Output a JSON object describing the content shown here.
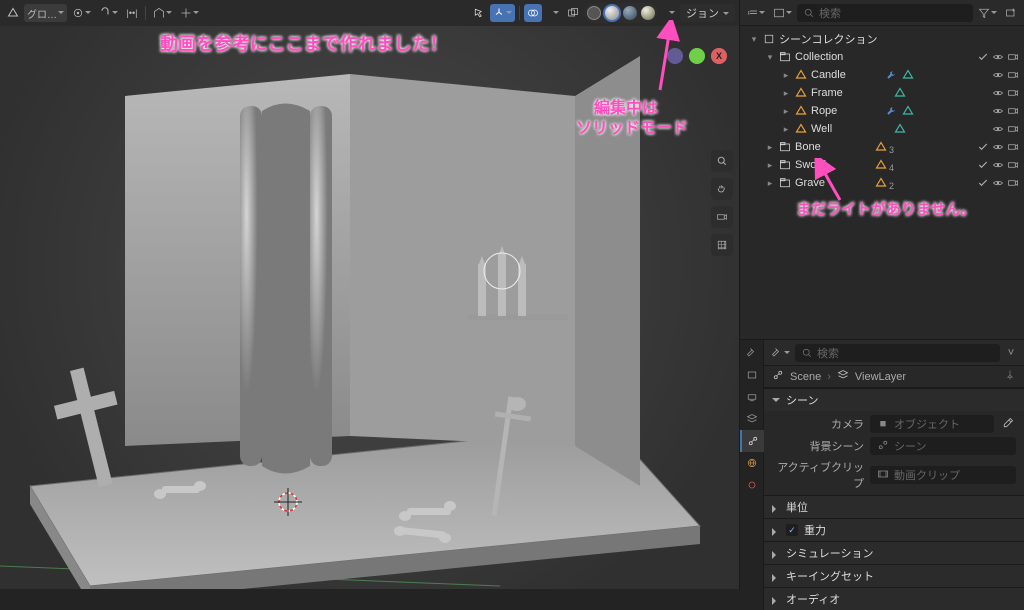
{
  "viewport": {
    "mode_label": "グロ…",
    "options_label": "ジョン",
    "shading_names": [
      "wireframe",
      "solid",
      "material",
      "rendered"
    ]
  },
  "annotations": {
    "top": "動画を参考にここまで作れました！",
    "mid1": "編集中は",
    "mid2": "ソリッドモード",
    "right": "まだライトがありません。"
  },
  "gizmo": {
    "x": "X",
    "y": "Y",
    "z": "Z"
  },
  "outliner": {
    "search_placeholder": "検索",
    "scene_collection": "シーンコレクション",
    "rows": [
      {
        "depth": 0,
        "tw": "▾",
        "icon": "scene",
        "label": "シーンコレクション",
        "icons": []
      },
      {
        "depth": 1,
        "tw": "▾",
        "icon": "coll",
        "label": "Collection",
        "icons": [
          "chk",
          "eye",
          "cam"
        ]
      },
      {
        "depth": 2,
        "tw": "▸",
        "icon": "mesh",
        "label": "Candle",
        "mods": [
          "wrench",
          "vg"
        ],
        "icons": [
          "eye",
          "cam"
        ]
      },
      {
        "depth": 2,
        "tw": "▸",
        "icon": "mesh",
        "label": "Frame",
        "mods": [
          "vg"
        ],
        "icons": [
          "eye",
          "cam"
        ]
      },
      {
        "depth": 2,
        "tw": "▸",
        "icon": "mesh",
        "label": "Rope",
        "mods": [
          "wrench",
          "vg"
        ],
        "icons": [
          "eye",
          "cam"
        ]
      },
      {
        "depth": 2,
        "tw": "▸",
        "icon": "mesh",
        "label": "Well",
        "mods": [
          "vg"
        ],
        "icons": [
          "eye",
          "cam"
        ]
      },
      {
        "depth": 1,
        "tw": "▸",
        "icon": "coll",
        "label": "Bone",
        "count": "3",
        "icons": [
          "chk",
          "eye",
          "cam"
        ]
      },
      {
        "depth": 1,
        "tw": "▸",
        "icon": "coll",
        "label": "Sword",
        "count": "4",
        "icons": [
          "chk",
          "eye",
          "cam"
        ]
      },
      {
        "depth": 1,
        "tw": "▸",
        "icon": "coll",
        "label": "Grave",
        "count": "2",
        "icons": [
          "chk",
          "eye",
          "cam"
        ]
      }
    ]
  },
  "properties": {
    "search_placeholder": "検索",
    "crumb_scene": "Scene",
    "crumb_layer": "ViewLayer",
    "sections": {
      "scene": "シーン",
      "camera": "カメラ",
      "bg_scene": "背景シーン",
      "active_clip": "アクティブクリップ",
      "camera_ph": "オブジェクト",
      "bg_ph": "シーン",
      "clip_ph": "動画クリップ",
      "units": "単位",
      "gravity": "重力",
      "sim": "シミュレーション",
      "keying": "キーイングセット",
      "audio": "オーディオ"
    }
  }
}
